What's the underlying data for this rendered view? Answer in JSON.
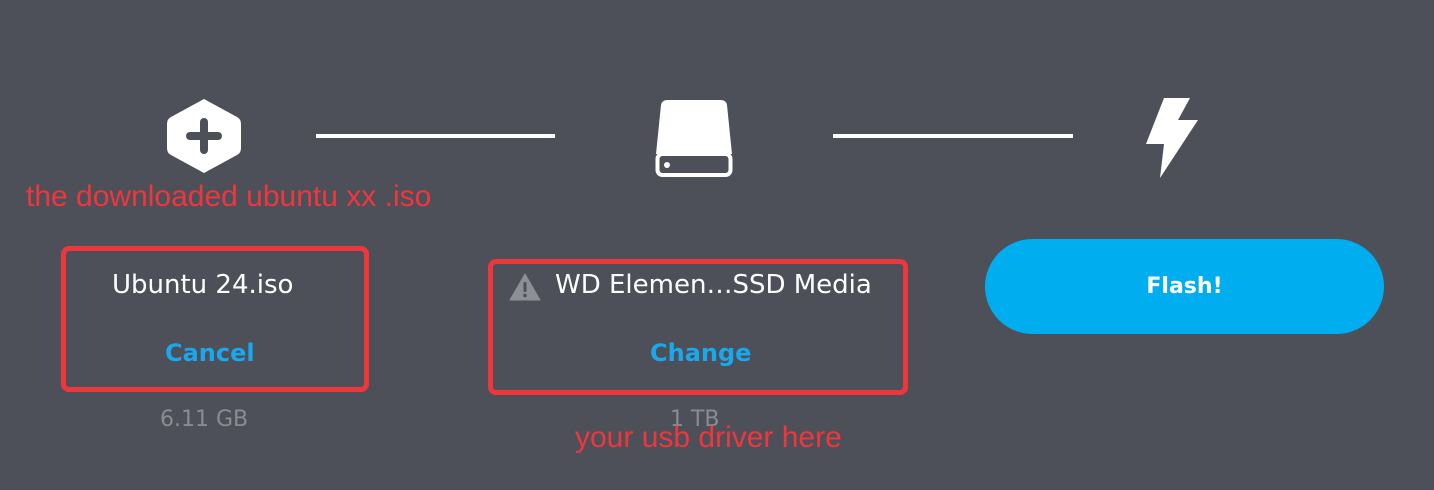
{
  "steps": {
    "image": {
      "icon": "plus-hexagon-icon",
      "file_name": "Ubuntu 24.iso",
      "action_label": "Cancel",
      "size": "6.11 GB"
    },
    "drive": {
      "icon": "hard-drive-icon",
      "warning_icon": "warning-triangle-icon",
      "name": "WD Elemen…SSD Media",
      "action_label": "Change",
      "size": "1 TB"
    },
    "flash": {
      "icon": "lightning-bolt-icon",
      "button_label": "Flash!"
    }
  },
  "annotations": {
    "image_note": "the downloaded ubuntu xx .iso",
    "drive_note": "your usb driver here"
  },
  "colors": {
    "background": "#4e5059",
    "accent": "#00aeef",
    "link": "#1aa7ec",
    "annotation": "#f0363d"
  }
}
